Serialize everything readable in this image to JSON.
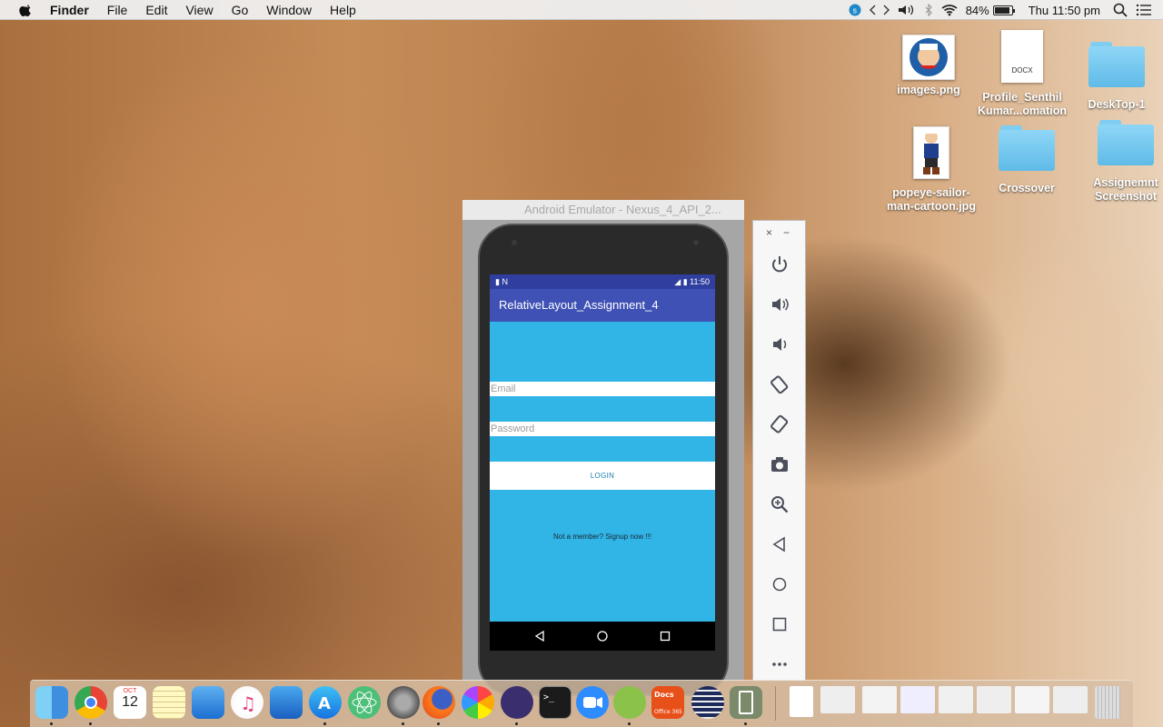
{
  "menubar": {
    "app": "Finder",
    "menus": [
      "File",
      "Edit",
      "View",
      "Go",
      "Window",
      "Help"
    ],
    "battery": "84%",
    "clock": "Thu 11:50 pm"
  },
  "desktop": {
    "icons": [
      {
        "label": "images.png",
        "type": "image"
      },
      {
        "label": "Profile_Senthil Kumar...omation",
        "type": "docx",
        "badge": "DOCX"
      },
      {
        "label": "DeskTop-1",
        "type": "folder"
      },
      {
        "label": "popeye-sailor-man-cartoon.jpg",
        "type": "image"
      },
      {
        "label": "Crossover",
        "type": "folder"
      },
      {
        "label": "Assignemnt Screenshot",
        "type": "folder"
      }
    ]
  },
  "emulator": {
    "title": "Android Emulator - Nexus_4_API_2...",
    "status_time": "11:50",
    "app_title": "RelativeLayout_Assignment_4",
    "email_placeholder": "Email",
    "password_placeholder": "Password",
    "login_label": "LOGIN",
    "signup_text": "Not a member? Signup now !!!",
    "colors": {
      "background": "#31b4e6",
      "appbar": "#3f51b5",
      "statusbar": "#303f9f"
    }
  },
  "sidepanel": {
    "close": "×",
    "minimize": "−",
    "buttons": [
      "power-icon",
      "volume-up-icon",
      "volume-down-icon",
      "rotate-left-icon",
      "rotate-right-icon",
      "camera-icon",
      "zoom-icon",
      "back-icon",
      "home-icon",
      "overview-icon",
      "more-icon"
    ]
  },
  "dock": {
    "apps": [
      "finder",
      "chrome",
      "calendar",
      "notes",
      "keynote",
      "itunes",
      "xcode",
      "app-store",
      "atom",
      "system-preferences",
      "firefox",
      "photos",
      "eclipse",
      "terminal",
      "zoom",
      "android-studio",
      "docs-office-365",
      "sublime",
      "emulator"
    ],
    "calendar_month": "OCT",
    "calendar_day": "12"
  }
}
